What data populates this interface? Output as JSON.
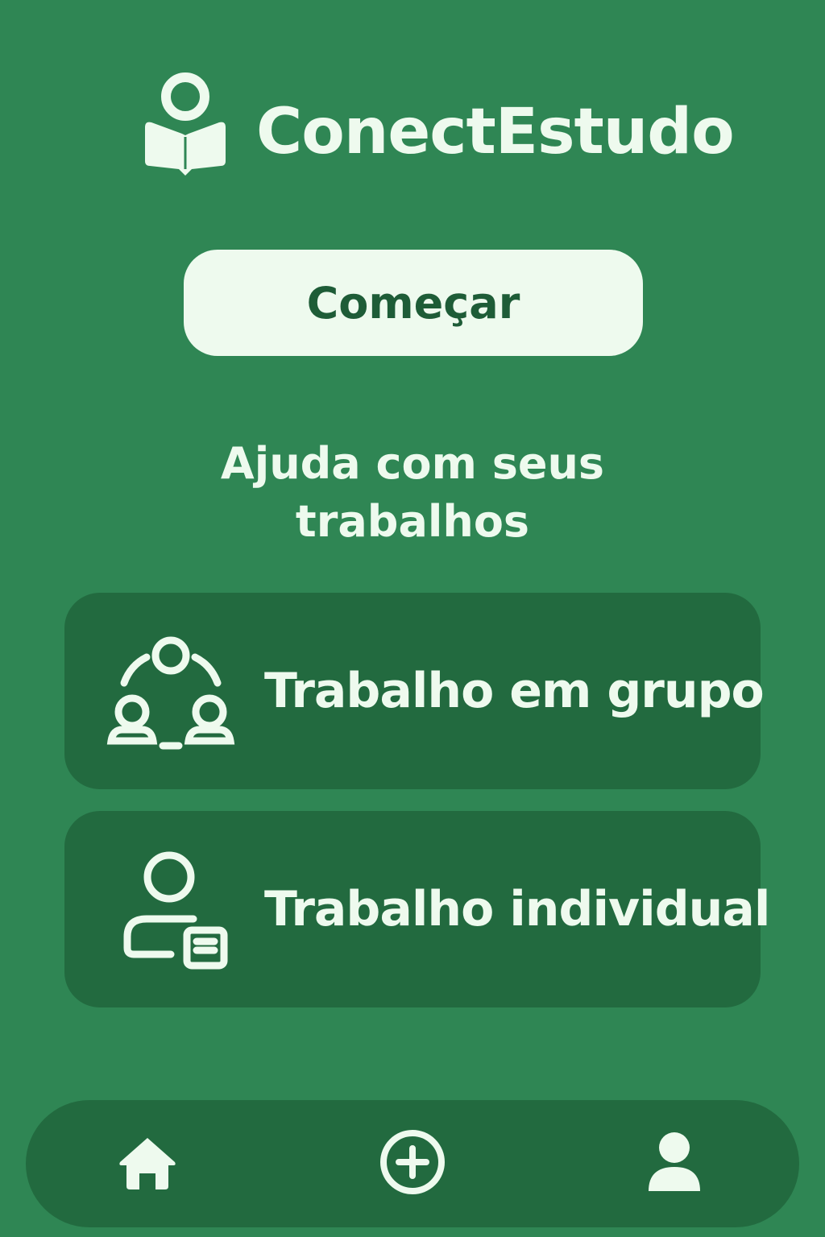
{
  "app": {
    "title": "ConectEstudo",
    "logo_icon": "person-reading-book-icon"
  },
  "start_button": {
    "label": "Começar"
  },
  "subtitle": {
    "text": "Ajuda com seus trabalhos"
  },
  "options": [
    {
      "label": "Trabalho em grupo",
      "icon": "group-icon"
    },
    {
      "label": "Trabalho individual",
      "icon": "person-document-icon"
    }
  ],
  "bottom_nav": {
    "items": [
      {
        "icon": "home-icon"
      },
      {
        "icon": "add-circle-icon"
      },
      {
        "icon": "profile-icon"
      }
    ]
  },
  "colors": {
    "background": "#2f8654",
    "card": "#226a3f",
    "text_light": "#eefaee",
    "button_text": "#1e5c37"
  }
}
